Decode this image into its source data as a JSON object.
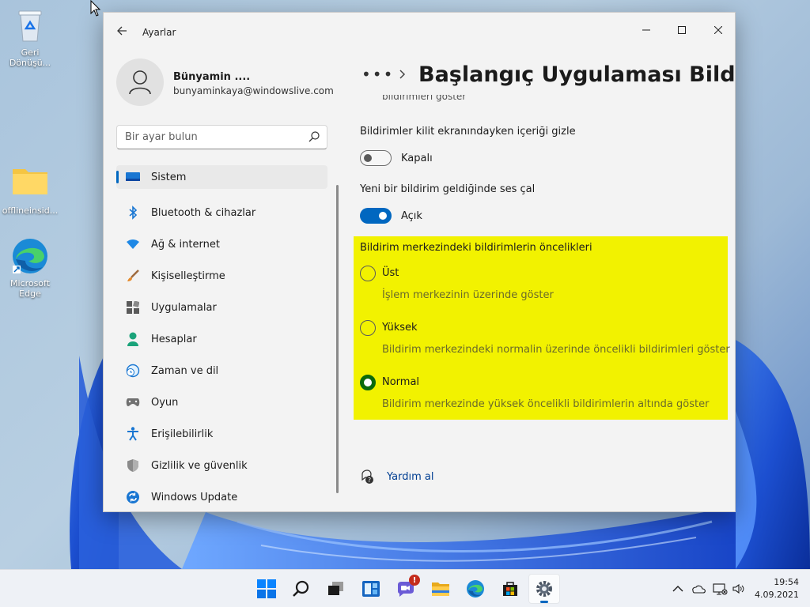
{
  "desktop": {
    "icons": [
      {
        "label": "Geri Dönüşü...",
        "icon": "recycle-bin-icon"
      },
      {
        "label": "offlineinsid...",
        "icon": "folder-icon"
      },
      {
        "label": "Microsoft Edge",
        "icon": "edge-icon"
      }
    ]
  },
  "window": {
    "app_title": "Ayarlar",
    "user": {
      "name": "Bünyamin ....",
      "email": "bunyaminkaya@windowslive.com"
    },
    "search": {
      "placeholder": "Bir ayar bulun"
    },
    "nav": [
      {
        "label": "Sistem",
        "icon": "system-icon",
        "active": true
      },
      {
        "label": "Bluetooth & cihazlar",
        "icon": "bluetooth-icon"
      },
      {
        "label": "Ağ & internet",
        "icon": "wifi-icon"
      },
      {
        "label": "Kişiselleştirme",
        "icon": "brush-icon"
      },
      {
        "label": "Uygulamalar",
        "icon": "apps-icon"
      },
      {
        "label": "Hesaplar",
        "icon": "accounts-icon"
      },
      {
        "label": "Zaman ve dil",
        "icon": "clock-globe-icon"
      },
      {
        "label": "Oyun",
        "icon": "gamepad-icon"
      },
      {
        "label": "Erişilebilirlik",
        "icon": "accessibility-icon"
      },
      {
        "label": "Gizlilik ve güvenlik",
        "icon": "shield-icon"
      },
      {
        "label": "Windows Update",
        "icon": "update-icon"
      }
    ],
    "breadcrumb": {
      "more": "•••",
      "title": "Başlangıç Uygulaması Bildirimi"
    },
    "clipped_text": "bildirimleri göster",
    "settings": {
      "lock_screen": {
        "label": "Bildirimler kilit ekranındayken içeriği gizle",
        "state": "Kapalı",
        "on": false
      },
      "sound": {
        "label": "Yeni bir bildirim geldiğinde ses çal",
        "state": "Açık",
        "on": true
      }
    },
    "priority": {
      "title": "Bildirim merkezindeki bildirimlerin öncelikleri",
      "highlight_color": "#f2f200",
      "options": [
        {
          "label": "Üst",
          "desc": "İşlem merkezinin üzerinde göster",
          "checked": false
        },
        {
          "label": "Yüksek",
          "desc": "Bildirim merkezindeki normalin üzerinde öncelikli bildirimleri göster",
          "checked": false
        },
        {
          "label": "Normal",
          "desc": "Bildirim merkezinde yüksek öncelikli bildirimlerin altında göster",
          "checked": true
        }
      ]
    },
    "help": {
      "label": "Yardım al"
    }
  },
  "taskbar": {
    "apps": [
      "start-icon",
      "search-icon",
      "task-view-icon",
      "widgets-icon",
      "chat-icon",
      "file-explorer-icon",
      "edge-icon",
      "store-icon",
      "settings-icon"
    ],
    "chat_badge": "!",
    "clock": {
      "time": "19:54",
      "date": "4.09.2021"
    }
  },
  "colors": {
    "accent": "#0067c0",
    "radio_checked": "#0b6a0b"
  }
}
